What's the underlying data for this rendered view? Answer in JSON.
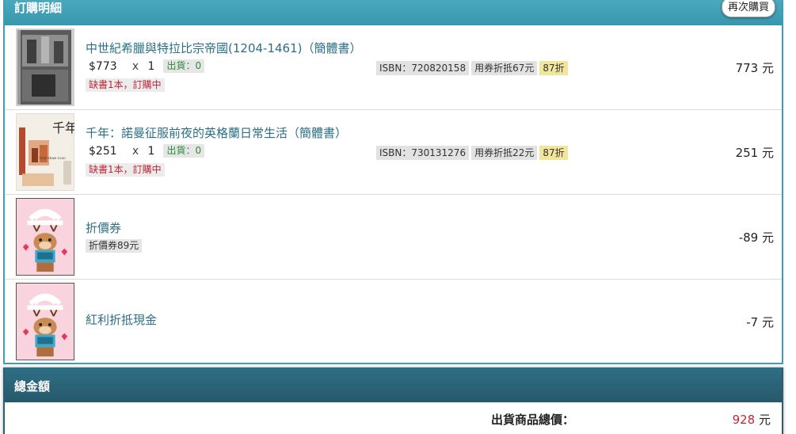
{
  "order": {
    "title": "訂購明細",
    "rebuy_label": "再次購買",
    "items": [
      {
        "name": "中世紀希臘與特拉比宗帝國(1204-1461)（簡體書）",
        "price": "$773",
        "times": "x",
        "qty": "1",
        "ship": "出貨：0",
        "isbn": "ISBN：720820158",
        "coupon_deduct": "用券折抵67元",
        "discount": "87折",
        "stock_status": "缺書1本，訂購中",
        "amount": "773 元"
      },
      {
        "name": "千年：諾曼征服前夜的英格蘭日常生活（簡體書）",
        "price": "$251",
        "times": "x",
        "qty": "1",
        "ship": "出貨：0",
        "isbn": "ISBN：730131276",
        "coupon_deduct": "用券折抵22元",
        "discount": "87折",
        "stock_status": "缺書1本，訂購中",
        "amount": "251 元",
        "cover_text": "千年",
        "cover_sub": "THE YEAR 1000"
      },
      {
        "name": "折價券",
        "tag": "折價券89元",
        "amount": "-89 元"
      },
      {
        "name": "紅利折抵現金",
        "amount": "-7 元"
      }
    ]
  },
  "total": {
    "title": "總金額",
    "label": "出貨商品總價：",
    "value": "928",
    "unit": " 元"
  },
  "colors": {
    "header": "#3997ad",
    "total_header": "#26586b",
    "link": "#2b6f86",
    "warn": "#c0263a",
    "ship": "#2e8b3a",
    "discount_tag": "#f2e59c"
  },
  "icons": {
    "coupon": "deer-mascot-icon"
  }
}
